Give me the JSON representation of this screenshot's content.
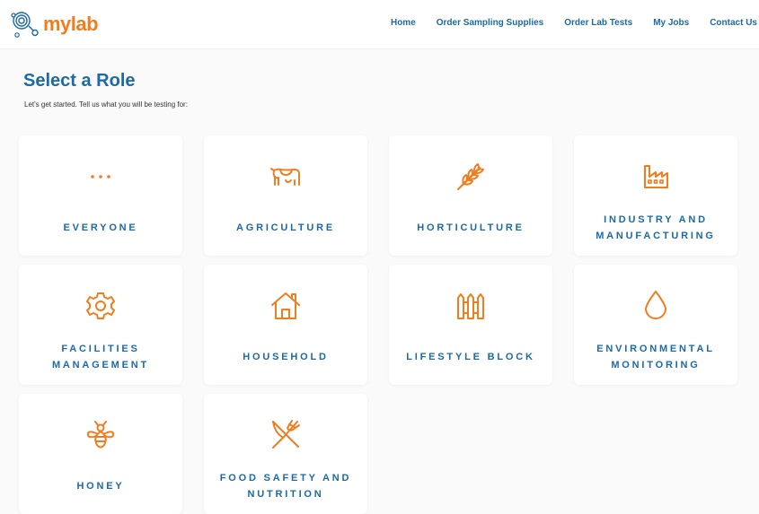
{
  "brand": {
    "name": "mylab",
    "accent": "#f07d1f",
    "primary": "#1c6aa4"
  },
  "nav": [
    {
      "label": "Home"
    },
    {
      "label": "Order Sampling Supplies"
    },
    {
      "label": "Order Lab Tests"
    },
    {
      "label": "My Jobs"
    },
    {
      "label": "Contact Us"
    }
  ],
  "page": {
    "title": "Select a Role",
    "subtitle": "Let's get started. Tell us what you will be testing for:"
  },
  "roles": [
    {
      "label": "EVERYONE",
      "icon": "ellipsis-icon"
    },
    {
      "label": "AGRICULTURE",
      "icon": "cow-icon"
    },
    {
      "label": "HORTICULTURE",
      "icon": "wheat-icon"
    },
    {
      "label": "INDUSTRY AND MANUFACTURING",
      "icon": "factory-icon"
    },
    {
      "label": "FACILITIES MANAGEMENT",
      "icon": "gear-icon"
    },
    {
      "label": "HOUSEHOLD",
      "icon": "house-icon"
    },
    {
      "label": "LIFESTYLE BLOCK",
      "icon": "fence-icon"
    },
    {
      "label": "ENVIRONMENTAL MONITORING",
      "icon": "water-drop-icon"
    },
    {
      "label": "HONEY",
      "icon": "bee-icon"
    },
    {
      "label": "FOOD SAFETY AND NUTRITION",
      "icon": "fork-knife-icon"
    }
  ]
}
